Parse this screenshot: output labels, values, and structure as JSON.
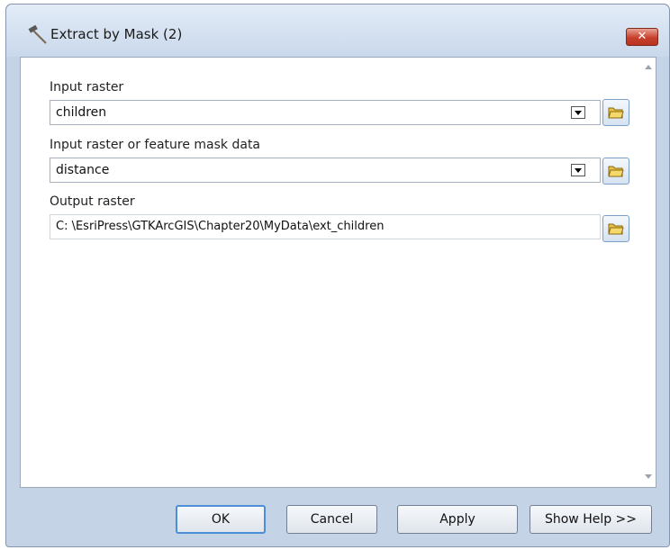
{
  "window": {
    "title": "Extract by Mask (2)",
    "close_label": "✕"
  },
  "form": {
    "input_raster": {
      "label": "Input raster",
      "value": "children"
    },
    "mask_data": {
      "label": "Input raster or feature mask data",
      "value": "distance"
    },
    "output_raster": {
      "label": "Output raster",
      "value": "C: \\EsriPress\\GTKArcGIS\\Chapter20\\MyData\\ext_children"
    }
  },
  "buttons": {
    "ok": "OK",
    "cancel": "Cancel",
    "apply": "Apply",
    "show_help": "Show Help >>"
  },
  "icons": {
    "title_icon": "hammer-tool-icon",
    "browse": "open-folder-icon",
    "dropdown": "chevron-down-icon",
    "scroll_up": "scroll-up-icon",
    "scroll_down": "scroll-down-icon"
  },
  "colors": {
    "close_button": "#c7402c",
    "frame": "#c4d3e6",
    "default_button_border": "#4c8fd6"
  }
}
